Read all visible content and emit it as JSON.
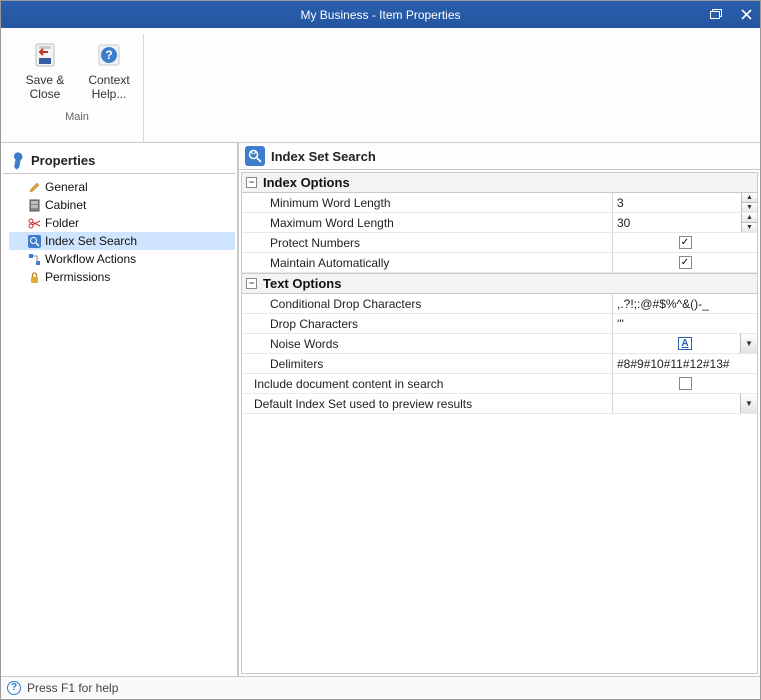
{
  "titlebar": {
    "text": "My Business - Item Properties"
  },
  "ribbon": {
    "save_close": "Save &\nClose",
    "context_help": "Context\nHelp...",
    "group_label": "Main"
  },
  "sidebar": {
    "header": "Properties",
    "items": [
      {
        "label": "General"
      },
      {
        "label": "Cabinet"
      },
      {
        "label": "Folder"
      },
      {
        "label": "Index Set Search"
      },
      {
        "label": "Workflow Actions"
      },
      {
        "label": "Permissions"
      }
    ]
  },
  "main": {
    "header": "Index Set Search",
    "sections": {
      "index_options": "Index Options",
      "text_options": "Text Options"
    },
    "rows": {
      "min_word_length": {
        "label": "Minimum Word Length",
        "value": "3"
      },
      "max_word_length": {
        "label": "Maximum Word Length",
        "value": "30"
      },
      "protect_numbers": {
        "label": "Protect Numbers",
        "checked": true
      },
      "maintain_auto": {
        "label": "Maintain Automatically",
        "checked": true
      },
      "cond_drop": {
        "label": "Conditional Drop Characters",
        "value": ",.?!;:@#$%^&()-_"
      },
      "drop_chars": {
        "label": "Drop Characters",
        "value": "'''"
      },
      "noise_words": {
        "label": "Noise Words",
        "value": "A"
      },
      "delimiters": {
        "label": "Delimiters",
        "value": "#8#9#10#11#12#13#"
      },
      "include_content": {
        "label": "Include document content in search",
        "checked": false
      },
      "default_index": {
        "label": "Default Index Set used to preview results",
        "value": ""
      }
    }
  },
  "statusbar": {
    "text": "Press F1 for help"
  }
}
